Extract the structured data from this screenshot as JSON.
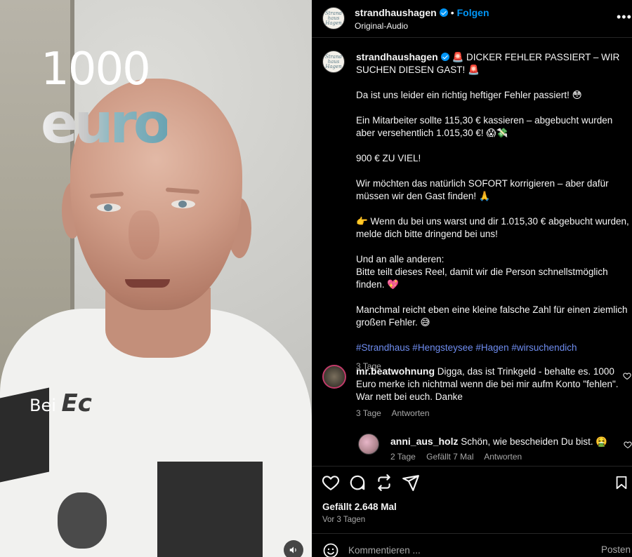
{
  "media": {
    "overlay_number": "1000",
    "overlay_word": "euro",
    "overlay_bei_prefix": "Bei",
    "overlay_bei_suffix": "Ec",
    "sound_icon": "speaker-icon"
  },
  "header": {
    "username": "strandhaushagen",
    "follow_label": "Folgen",
    "audio": "Original-Audio",
    "avatar_text": "Strand haus Hagen"
  },
  "caption": {
    "username": "strandhaushagen",
    "title": "🚨 DICKER FEHLER PASSIERT – WIR SUCHEN DIESEN GAST! 🚨",
    "paragraphs": [
      "Da ist uns leider ein richtig heftiger Fehler passiert! 😳",
      "Ein Mitarbeiter sollte 115,30 € kassieren – abgebucht wurden aber versehentlich 1.015,30 €! 😱💸",
      "900 € ZU VIEL!",
      "Wir möchten das natürlich SOFORT korrigieren – aber dafür müssen wir den Gast finden! 🙏",
      "👉 Wenn du bei uns warst und dir 1.015,30 € abgebucht wurden, melde dich bitte dringend bei uns!",
      "Und an alle anderen:\nBitte teilt dieses Reel, damit wir die Person schnellstmöglich finden. 💖",
      "Manchmal reicht eben eine kleine falsche Zahl für einen ziemlich großen Fehler. 😅"
    ],
    "hashtags": "#Strandhaus #Hengsteysee #Hagen #wirsuchendich",
    "age": "3 Tage"
  },
  "comments": [
    {
      "username": "mr.beatwohnung",
      "text": "Digga, das ist Trinkgeld - behalte es. 1000 Euro merke ich nichtmal wenn die bei mir aufm Konto \"fehlen\". War nett bei euch. Danke",
      "age": "3 Tage",
      "reply_label": "Antworten",
      "likes_label": ""
    },
    {
      "username": "anni_aus_holz",
      "text": "Schön, wie bescheiden Du bist. 🤮",
      "age": "2 Tage",
      "likes_label": "Gefällt 7 Mal",
      "reply_label": "Antworten"
    }
  ],
  "actions": {
    "icons": [
      "heart-icon",
      "comment-icon",
      "repost-icon",
      "share-icon",
      "bookmark-icon"
    ],
    "likes": "Gefällt 2.648 Mal",
    "ago": "Vor 3 Tagen"
  },
  "composer": {
    "placeholder": "Kommentieren ...",
    "post_label": "Posten"
  },
  "colors": {
    "link_blue": "#0095f6",
    "hashtag": "#6f8df0",
    "muted": "#a8a8a8",
    "background": "#000000"
  }
}
